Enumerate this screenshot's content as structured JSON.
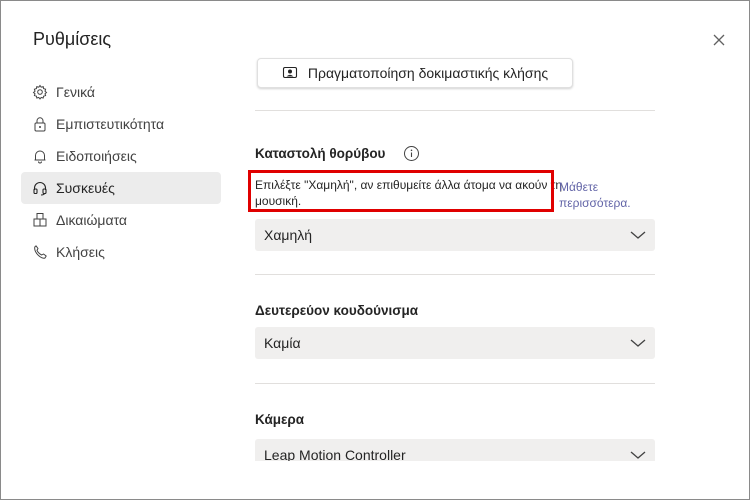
{
  "dialog": {
    "title": "Ρυθμίσεις"
  },
  "sidebar": {
    "items": [
      {
        "label": "Γενικά",
        "icon": "gear-icon",
        "active": false
      },
      {
        "label": "Εμπιστευτικότητα",
        "icon": "lock-icon",
        "active": false
      },
      {
        "label": "Ειδοποιήσεις",
        "icon": "bell-icon",
        "active": false
      },
      {
        "label": "Συσκευές",
        "icon": "headset-icon",
        "active": true
      },
      {
        "label": "Δικαιώματα",
        "icon": "grid-icon",
        "active": false
      },
      {
        "label": "Κλήσεις",
        "icon": "phone-icon",
        "active": false
      }
    ]
  },
  "devices": {
    "test_call_label": "Πραγματοποίηση δοκιμαστικής κλήσης",
    "noise_suppression": {
      "title": "Καταστολή θορύβου",
      "description": "Επιλέξτε \"Χαμηλή\", αν επιθυμείτε άλλα άτομα να ακούν τη μουσική.",
      "learn_more": "Μάθετε περισσότερα.",
      "selected": "Χαμηλή"
    },
    "secondary_ringer": {
      "title": "Δευτερεύον κουδούνισμα",
      "selected": "Καμία"
    },
    "camera": {
      "title": "Κάμερα",
      "selected": "Leap Motion Controller"
    }
  },
  "colors": {
    "accent": "#6264a7",
    "highlight": "#e00000",
    "active_bg": "#ececec"
  }
}
